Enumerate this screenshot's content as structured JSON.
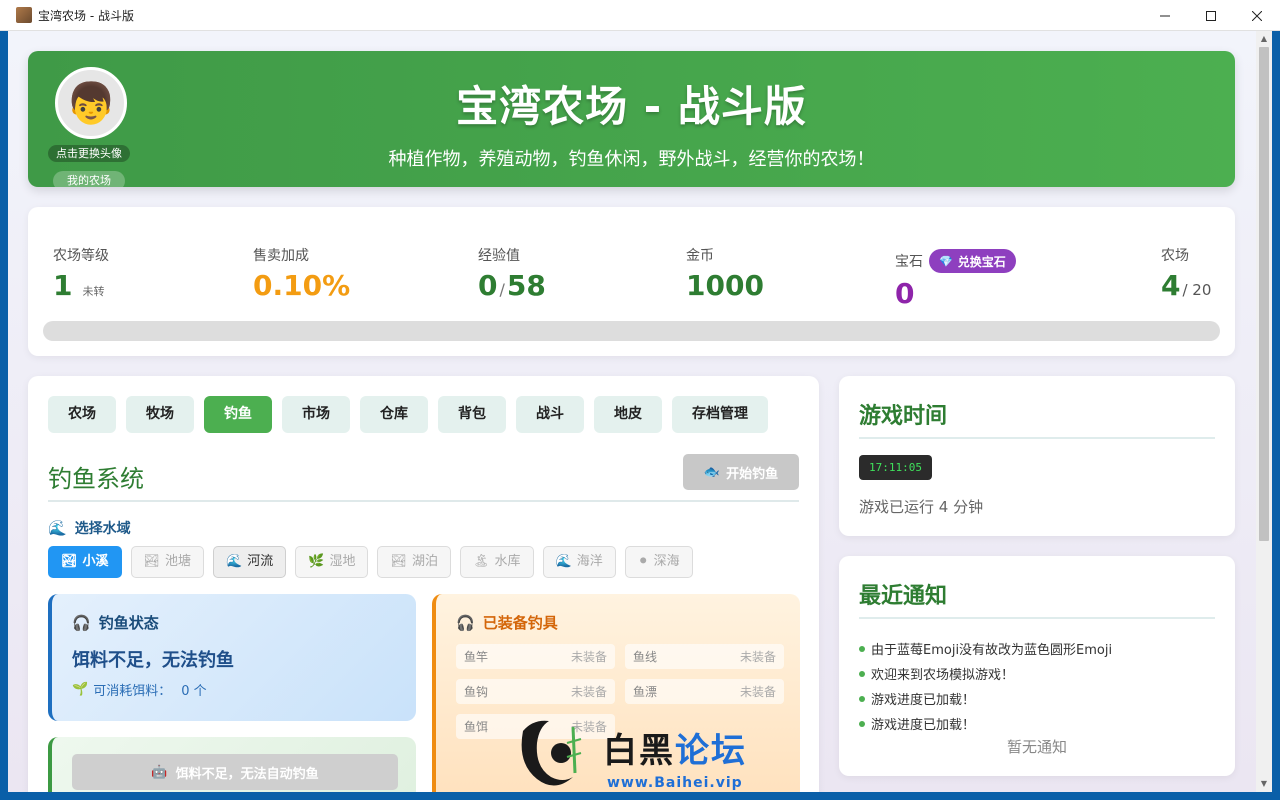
{
  "window": {
    "title": "宝湾农场 - 战斗版",
    "controls": {
      "minimize": "—",
      "maximize": "☐",
      "close": "✕"
    }
  },
  "header": {
    "avatar_emoji": "👦",
    "avatar_caption": "点击更换头像",
    "my_farm_label": "我的农场",
    "title": "宝湾农场 - 战斗版",
    "subtitle": "种植作物，养殖动物，钓鱼休闲，野外战斗，经营你的农场！"
  },
  "stats": {
    "level": {
      "label": "农场等级",
      "value": "1",
      "note": "未转"
    },
    "sell_bonus": {
      "label": "售卖加成",
      "value": "0.10%"
    },
    "exp": {
      "label": "经验值",
      "value": "0",
      "max": "58"
    },
    "gold": {
      "label": "金币",
      "value": "1000"
    },
    "gems": {
      "label": "宝石",
      "value": "0",
      "exchange_label": "兑换宝石"
    },
    "farms": {
      "label": "农场",
      "value": "4",
      "max": "/ 20"
    },
    "exp_progress": 0
  },
  "tabs": [
    "农场",
    "牧场",
    "钓鱼",
    "市场",
    "仓库",
    "背包",
    "战斗",
    "地皮",
    "存档管理"
  ],
  "active_tab": "钓鱼",
  "fishing": {
    "section_title": "钓鱼系统",
    "start_button": "开始钓鱼",
    "water_label": "选择水域",
    "waters": [
      {
        "label": "小溪",
        "icon": "🏞",
        "state": "active"
      },
      {
        "label": "池塘",
        "icon": "🏞",
        "state": "disabled"
      },
      {
        "label": "河流",
        "icon": "🌊",
        "state": "enabled"
      },
      {
        "label": "湿地",
        "icon": "🌿",
        "state": "disabled"
      },
      {
        "label": "湖泊",
        "icon": "🏞",
        "state": "disabled"
      },
      {
        "label": "水库",
        "icon": "🏝",
        "state": "disabled"
      },
      {
        "label": "海洋",
        "icon": "🌊",
        "state": "disabled"
      },
      {
        "label": "深海",
        "icon": "⚫",
        "state": "disabled"
      }
    ],
    "status": {
      "title": "钓鱼状态",
      "message": "饵料不足，无法钓鱼",
      "bait_label": "可消耗饵料：",
      "bait_value": "0 个"
    },
    "gear": {
      "title": "已装备钓具",
      "items": [
        {
          "name": "鱼竿",
          "value": "未装备"
        },
        {
          "name": "鱼线",
          "value": "未装备"
        },
        {
          "name": "鱼钩",
          "value": "未装备"
        },
        {
          "name": "鱼漂",
          "value": "未装备"
        },
        {
          "name": "鱼饵",
          "value": "未装备"
        }
      ]
    },
    "auto_button": "饵料不足，无法自动钓鱼"
  },
  "game_time": {
    "title": "游戏时间",
    "clock": "17:11:05",
    "runtime": "游戏已运行 4 分钟"
  },
  "notices": {
    "title": "最近通知",
    "items": [
      "由于蓝莓Emoji没有故改为蓝色圆形Emoji",
      "欢迎来到农场模拟游戏！",
      "游戏进度已加载！",
      "游戏进度已加载！"
    ],
    "empty_text": "暂无通知"
  },
  "watermark": {
    "text_black": "白黑",
    "text_blue": "论坛",
    "url": "www.Baihei.vip"
  }
}
